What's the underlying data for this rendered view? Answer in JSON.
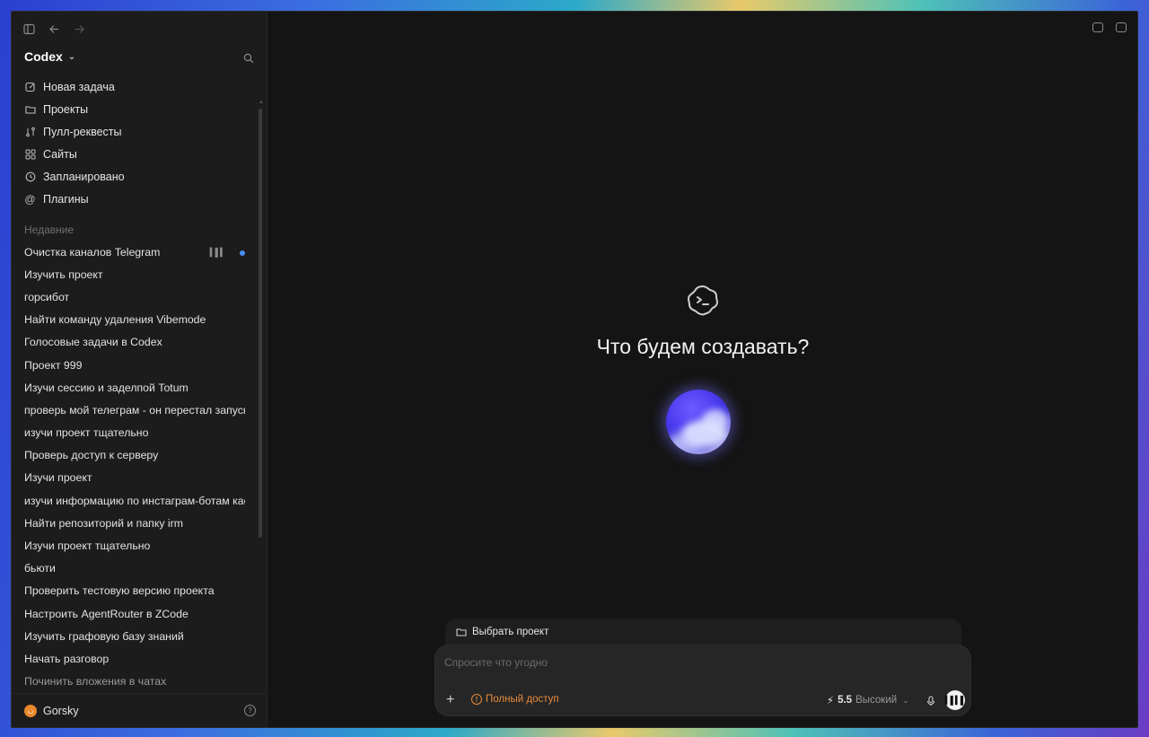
{
  "app": {
    "name": "Codex"
  },
  "sidebar": {
    "nav": [
      {
        "label": "Новая задача",
        "icon": "edit-icon"
      },
      {
        "label": "Проекты",
        "icon": "folder-icon"
      },
      {
        "label": "Пулл-реквесты",
        "icon": "pull-request-icon"
      },
      {
        "label": "Сайты",
        "icon": "grid-icon"
      },
      {
        "label": "Запланировано",
        "icon": "clock-icon"
      },
      {
        "label": "Плагины",
        "icon": "at-icon"
      }
    ],
    "recent_heading": "Недавние",
    "recent": [
      "Очистка каналов Telegram",
      "Изучить проект",
      "горсибот",
      "Найти команду удаления Vibemode",
      "Голосовые задачи в Codex",
      "Проект 999",
      "Изучи сессию и заделпой Totum",
      "проверь мой телеграм - он перестал запуск",
      "изучи проект тщательно",
      "Проверь доступ к серверу",
      "Изучи проект",
      "изучи информацию по инстаграм-ботам кас",
      "Найти репозиторий и папку irm",
      "Изучи проект тщательно",
      "бьюти",
      "Проверить тестовую версию проекта",
      "Настроить AgentRouter в ZCode",
      "Изучить графовую базу знаний",
      "Начать разговор",
      "Починить вложения в чатах"
    ],
    "user": {
      "name": "Gorsky"
    }
  },
  "main": {
    "hero_title": "Что будем создавать?",
    "project_chip": "Выбрать проект",
    "composer": {
      "placeholder": "Спросите что угодно",
      "access_label": "Полный доступ",
      "model_version": "5.5",
      "model_level": "Высокий"
    }
  },
  "colors": {
    "accent_orange": "#e78a3c",
    "unread_dot": "#4a8ff0",
    "orb": "#4d3cf0"
  }
}
